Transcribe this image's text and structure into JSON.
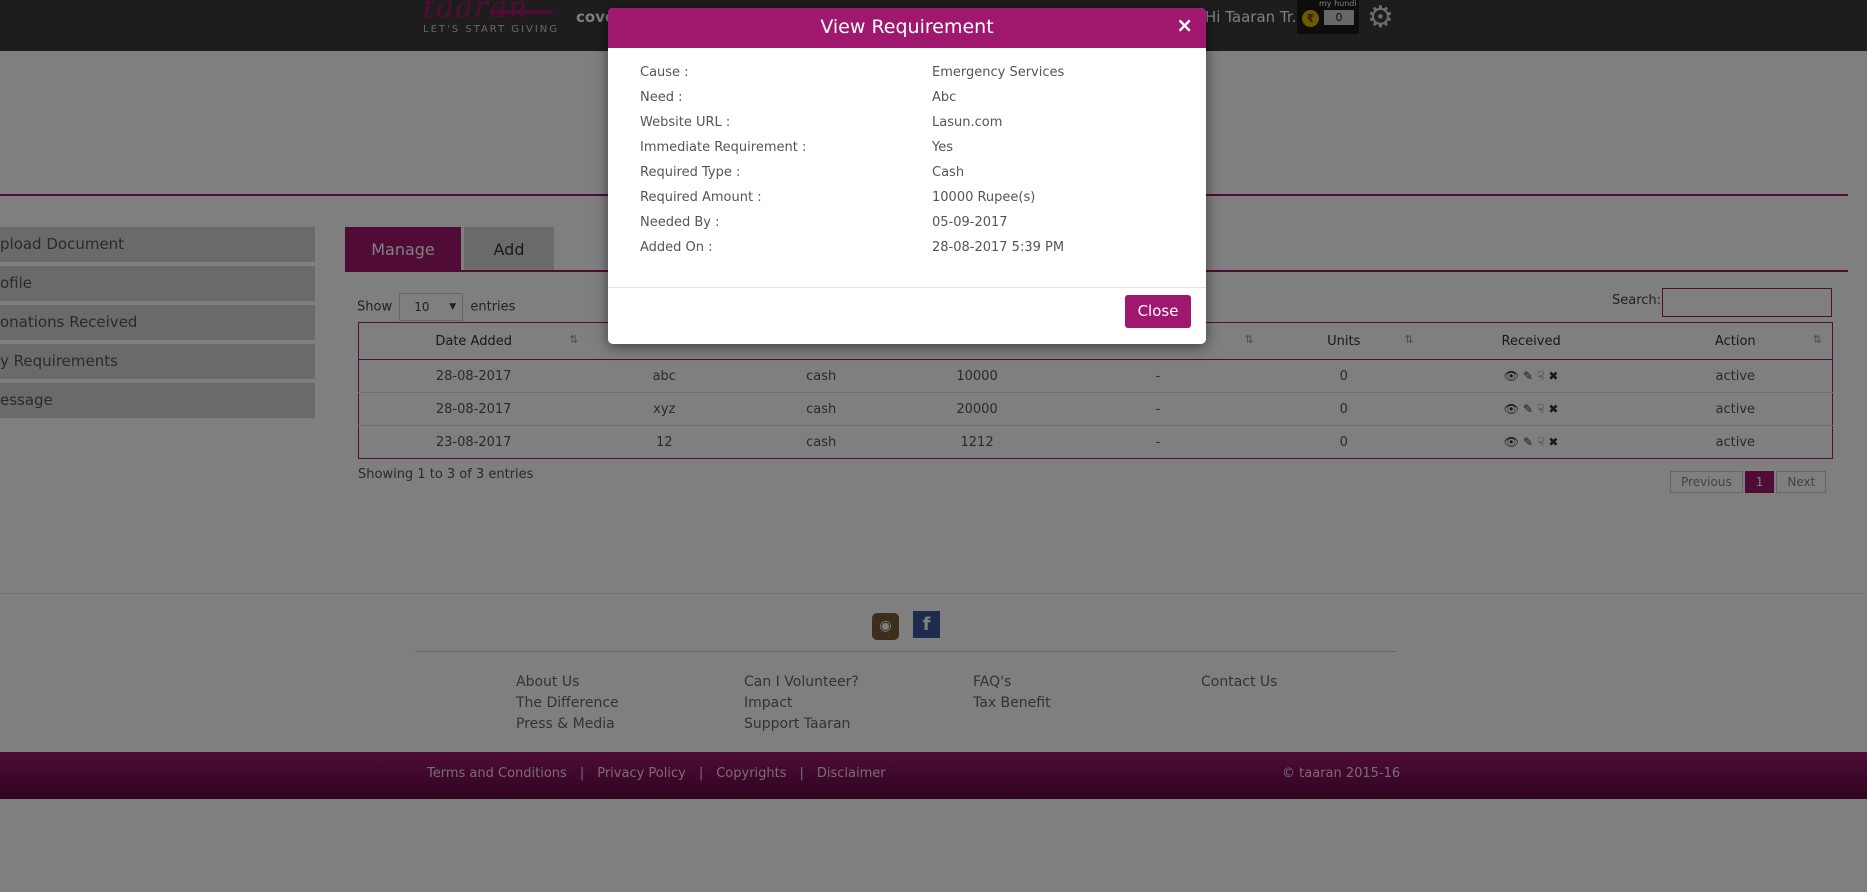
{
  "header": {
    "logo_script": "taaran",
    "logo_tagline": "LET'S START GIVING",
    "nav_partial": "cove",
    "greeting": "Hi Taaran Tr...",
    "hundi_label": "my hundi",
    "hundi_count": "0",
    "icons": {
      "coin": "rupee-coin-icon",
      "settings": "gear-icon"
    }
  },
  "sidebar": {
    "items": [
      "pload Document",
      "ofile",
      "onations Received",
      "y Requirements",
      "essage"
    ]
  },
  "tabs": [
    {
      "label": "Manage",
      "active": true
    },
    {
      "label": "Add",
      "active": false
    }
  ],
  "table_controls": {
    "show_label": "Show",
    "entries_value": "10",
    "entries_label": "entries",
    "search_label": "Search:",
    "search_value": ""
  },
  "table": {
    "columns": [
      "Date Added",
      "",
      "",
      "",
      "",
      "Units",
      "Received",
      "Action"
    ],
    "rows": [
      {
        "date": "28-08-2017",
        "need": "abc",
        "type": "cash",
        "amount": "10000",
        "dash": "-",
        "units": "0",
        "action": "active"
      },
      {
        "date": "28-08-2017",
        "need": "xyz",
        "type": "cash",
        "amount": "20000",
        "dash": "-",
        "units": "0",
        "action": "active"
      },
      {
        "date": "23-08-2017",
        "need": "12",
        "type": "cash",
        "amount": "1212",
        "dash": "-",
        "units": "0",
        "action": "active"
      }
    ]
  },
  "table_footer": {
    "showing": "Showing 1 to 3 of 3 entries",
    "previous": "Previous",
    "current_page": "1",
    "next": "Next"
  },
  "footer": {
    "links_col1": [
      "About Us",
      "The Difference",
      "Press & Media"
    ],
    "links_col2": [
      "Can I Volunteer?",
      "Impact",
      "Support Taaran"
    ],
    "links_col3": [
      "FAQ's",
      "Tax Benefit"
    ],
    "links_col4": [
      "Contact Us"
    ],
    "legal": [
      "Terms and Conditions",
      "Privacy Policy",
      "Copyrights",
      "Disclaimer"
    ],
    "legal_separator": "|",
    "copyright": "© taaran 2015-16"
  },
  "modal": {
    "title": "View Requirement",
    "close_x": "×",
    "fields": [
      {
        "label": "Cause :",
        "value": "Emergency Services"
      },
      {
        "label": "Need :",
        "value": "Abc"
      },
      {
        "label": "Website URL :",
        "value": "Lasun.com"
      },
      {
        "label": "Immediate Requirement :",
        "value": "Yes"
      },
      {
        "label": "Required Type :",
        "value": "Cash"
      },
      {
        "label": "Required Amount :",
        "value": "10000 Rupee(s)"
      },
      {
        "label": "Needed By :",
        "value": "05-09-2017"
      },
      {
        "label": "Added On :",
        "value": "28-08-2017 5:39 PM"
      }
    ],
    "close_button": "Close"
  },
  "colors": {
    "brand": "#a0176f",
    "topbar": "#3a3a3a",
    "sidebar_item": "#d4d4d4"
  }
}
